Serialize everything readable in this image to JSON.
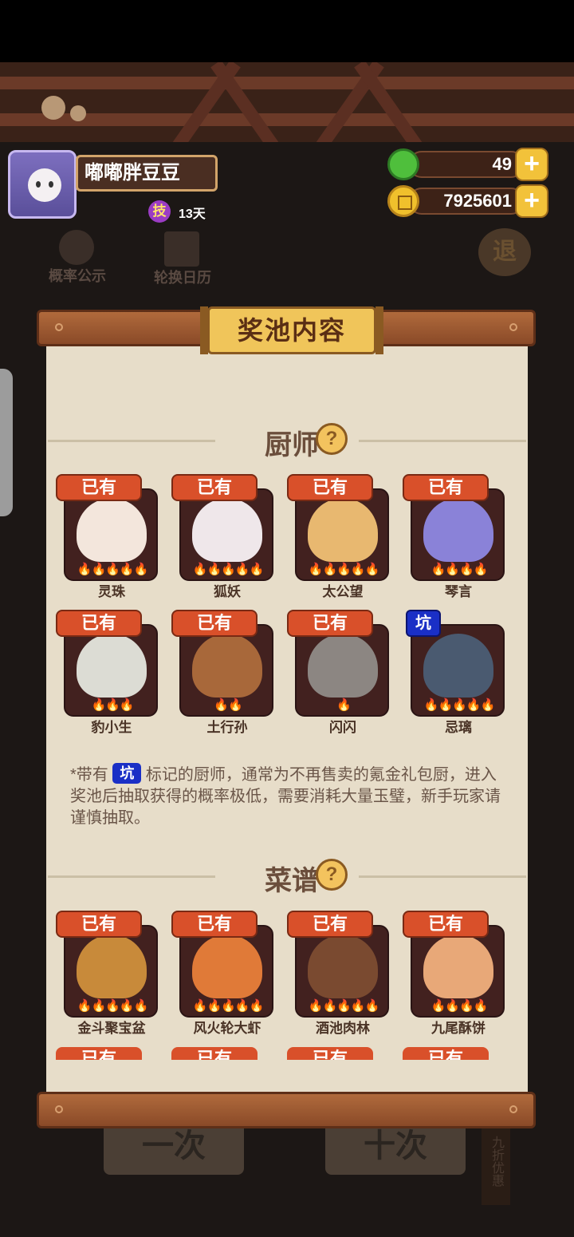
{
  "player": {
    "name": "嘟嘟胖豆豆",
    "skill_badge": "技",
    "days": "13天"
  },
  "resources": {
    "leaves": "49",
    "coins": "7925601",
    "plus": "+"
  },
  "background": {
    "probability_label": "概率公示",
    "calendar_label": "轮换日历",
    "exit_label": "退",
    "single_draw": "一次",
    "ten_draw": "十次",
    "discount": "九折优惠"
  },
  "panel": {
    "title": "奖池内容",
    "chef_section": "厨师",
    "recipe_section": "菜谱",
    "help": "?",
    "owned": "已有",
    "pit": "坑",
    "note_prefix": "*带有",
    "note_suffix": "标记的厨师，通常为不再售卖的氪金礼包厨，进入奖池后抽取获得的概率极低，需要消耗大量玉璧，新手玩家请谨慎抽取。"
  },
  "chefs": [
    {
      "name": "灵珠",
      "badge": "已有",
      "stars": 5,
      "color": "#f3e6dc"
    },
    {
      "name": "狐妖",
      "badge": "已有",
      "stars": 5,
      "color": "#efe7ea"
    },
    {
      "name": "太公望",
      "badge": "已有",
      "stars": 5,
      "color": "#e8b870"
    },
    {
      "name": "琴言",
      "badge": "已有",
      "stars": 4,
      "color": "#8a82d8"
    },
    {
      "name": "豹小生",
      "badge": "已有",
      "stars": 3,
      "color": "#dcdcd4"
    },
    {
      "name": "土行孙",
      "badge": "已有",
      "stars": 2,
      "color": "#a8683a"
    },
    {
      "name": "闪闪",
      "badge": "已有",
      "stars": 1,
      "color": "#8c8682"
    },
    {
      "name": "忌璃",
      "badge": "坑",
      "stars": 5,
      "color": "#4a5a70"
    }
  ],
  "recipes": [
    {
      "name": "金斗聚宝盆",
      "badge": "已有",
      "stars": 5,
      "color": "#c88a3a"
    },
    {
      "name": "风火轮大虾",
      "badge": "已有",
      "stars": 5,
      "color": "#e07a38"
    },
    {
      "name": "酒池肉林",
      "badge": "已有",
      "stars": 5,
      "color": "#7a4a30"
    },
    {
      "name": "九尾酥饼",
      "badge": "已有",
      "stars": 4,
      "color": "#e8a878"
    }
  ],
  "next_row_badges": [
    "已有",
    "已有",
    "已有",
    "已有"
  ]
}
